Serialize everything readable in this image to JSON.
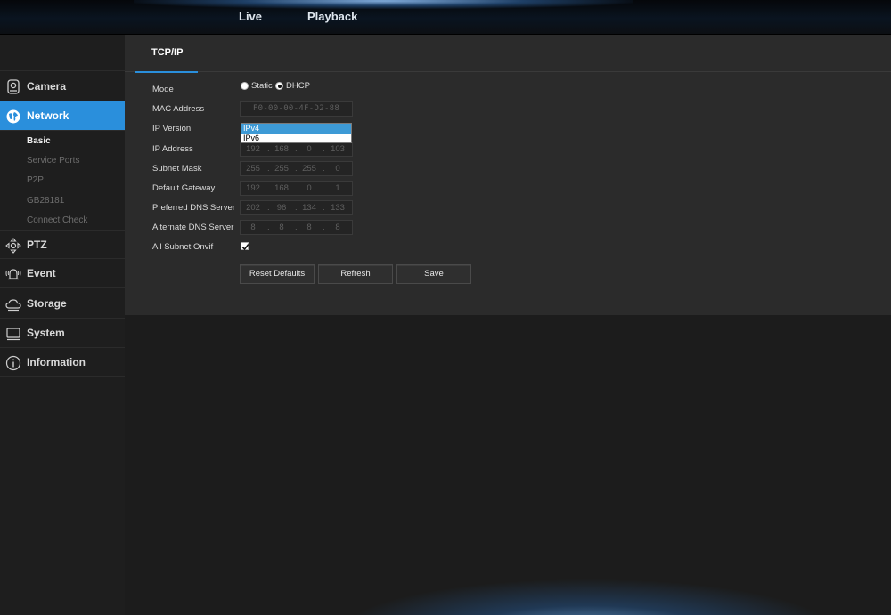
{
  "topnav": {
    "live": "Live",
    "playback": "Playback"
  },
  "sidebar": {
    "groups": [
      {
        "label": "Camera",
        "icon": "camera-icon"
      },
      {
        "label": "Network",
        "icon": "network-globe-icon",
        "active": true
      },
      {
        "label": "PTZ",
        "icon": "ptz-arrows-icon"
      },
      {
        "label": "Event",
        "icon": "alarm-icon"
      },
      {
        "label": "Storage",
        "icon": "cloud-storage-icon"
      },
      {
        "label": "System",
        "icon": "monitor-icon"
      },
      {
        "label": "Information",
        "icon": "info-icon"
      }
    ],
    "network_sub": [
      "Basic",
      "Service Ports",
      "P2P",
      "GB28181",
      "Connect Check"
    ]
  },
  "tabs": [
    {
      "label": "TCP/IP",
      "active": true
    }
  ],
  "form": {
    "mode_label": "Mode",
    "mode_options": [
      "Static",
      "DHCP"
    ],
    "mode_selected": "DHCP",
    "mac_label": "MAC Address",
    "mac_value": "F0-00-00-4F-D2-88",
    "ipversion_label": "IP Version",
    "ipversion_options": [
      "IPv4",
      "IPv6"
    ],
    "ipversion_selected": "IPv4",
    "ip_label": "IP Address",
    "ip_value": [
      "192",
      "168",
      "0",
      "103"
    ],
    "subnet_label": "Subnet Mask",
    "subnet_value": [
      "255",
      "255",
      "255",
      "0"
    ],
    "gateway_label": "Default Gateway",
    "gateway_value": [
      "192",
      "168",
      "0",
      "1"
    ],
    "pdns_label": "Preferred DNS Server",
    "pdns_value": [
      "202",
      "96",
      "134",
      "133"
    ],
    "adns_label": "Alternate DNS Server",
    "adns_value": [
      "8",
      "8",
      "8",
      "8"
    ],
    "onvif_label": "All Subnet Onvif",
    "onvif_checked": true
  },
  "buttons": {
    "reset": "Reset Defaults",
    "refresh": "Refresh",
    "save": "Save"
  },
  "colors": {
    "accent": "#2a8fdc",
    "dropdown_highlight": "#3d9ad6",
    "panel_bg": "#2b2b2b",
    "page_bg": "#1c1c1c"
  }
}
